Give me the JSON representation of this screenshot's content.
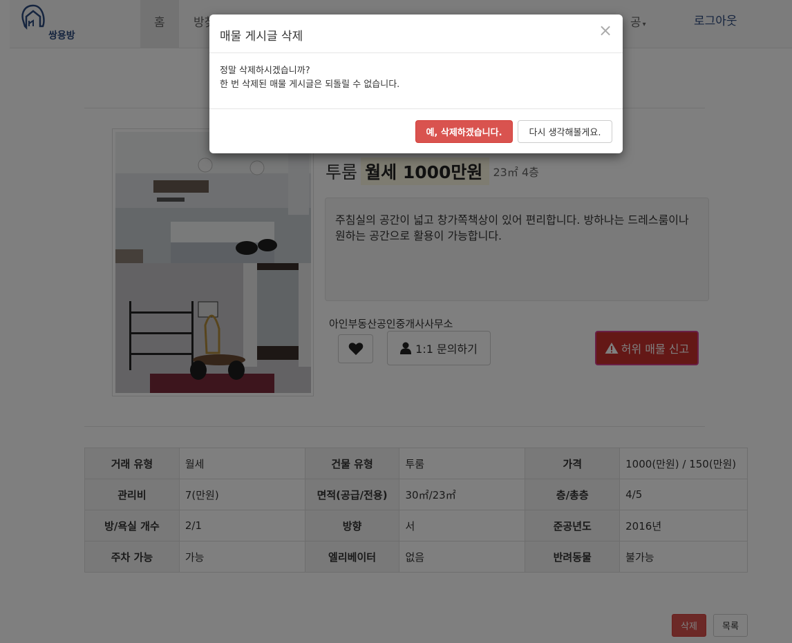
{
  "navbar": {
    "logo_text": "쌍용방",
    "home_label": "홈",
    "room_label_partial": "방찾",
    "partial_menu_label": "공",
    "logout_label": "로그아웃"
  },
  "listing": {
    "room_type": "투룸",
    "price": "월세 1000만원",
    "area_floor": "23㎡ 4층",
    "description": " 주침실의 공간이 넓고 창가쪽책상이 있어 편리합니다.  방하나는 드레스룸이나 원하는 공간으로 활용이 가능합니다.",
    "agency": "아인부동산공인중개사사무소",
    "inquiry_label": "1:1 문의하기",
    "report_label": "허위 매물 신고"
  },
  "details": {
    "rows": [
      [
        {
          "h": "거래 유형",
          "v": "월세"
        },
        {
          "h": "건물 유형",
          "v": "투룸"
        },
        {
          "h": "가격",
          "v": "1000(만원) / 150(만원)"
        }
      ],
      [
        {
          "h": "관리비",
          "v": "7(만원)"
        },
        {
          "h": "면적(공급/전용)",
          "v": "30㎡/23㎡"
        },
        {
          "h": "층/총층",
          "v": "4/5"
        }
      ],
      [
        {
          "h": "방/욕실 개수",
          "v": "2/1"
        },
        {
          "h": "방향",
          "v": "서"
        },
        {
          "h": "준공년도",
          "v": "2016년"
        }
      ],
      [
        {
          "h": "주차 가능",
          "v": "가능"
        },
        {
          "h": "엘리베이터",
          "v": "없음"
        },
        {
          "h": "반려동물",
          "v": "불가능"
        }
      ]
    ]
  },
  "actions": {
    "delete_label": "삭제",
    "list_label": "목록"
  },
  "modal": {
    "title": "매물 게시글 삭제",
    "close_symbol": "×",
    "line1": "정말 삭제하시겠습니까?",
    "line2": "한 번 삭제된 매물 게시글은 되돌릴 수 없습니다.",
    "confirm_label": "예, 삭제하겠습니다.",
    "cancel_label": "다시 생각해볼게요."
  },
  "colors": {
    "danger": "#d9534f",
    "brand": "#2c4a7e",
    "highlight": "#fcf8e3"
  }
}
